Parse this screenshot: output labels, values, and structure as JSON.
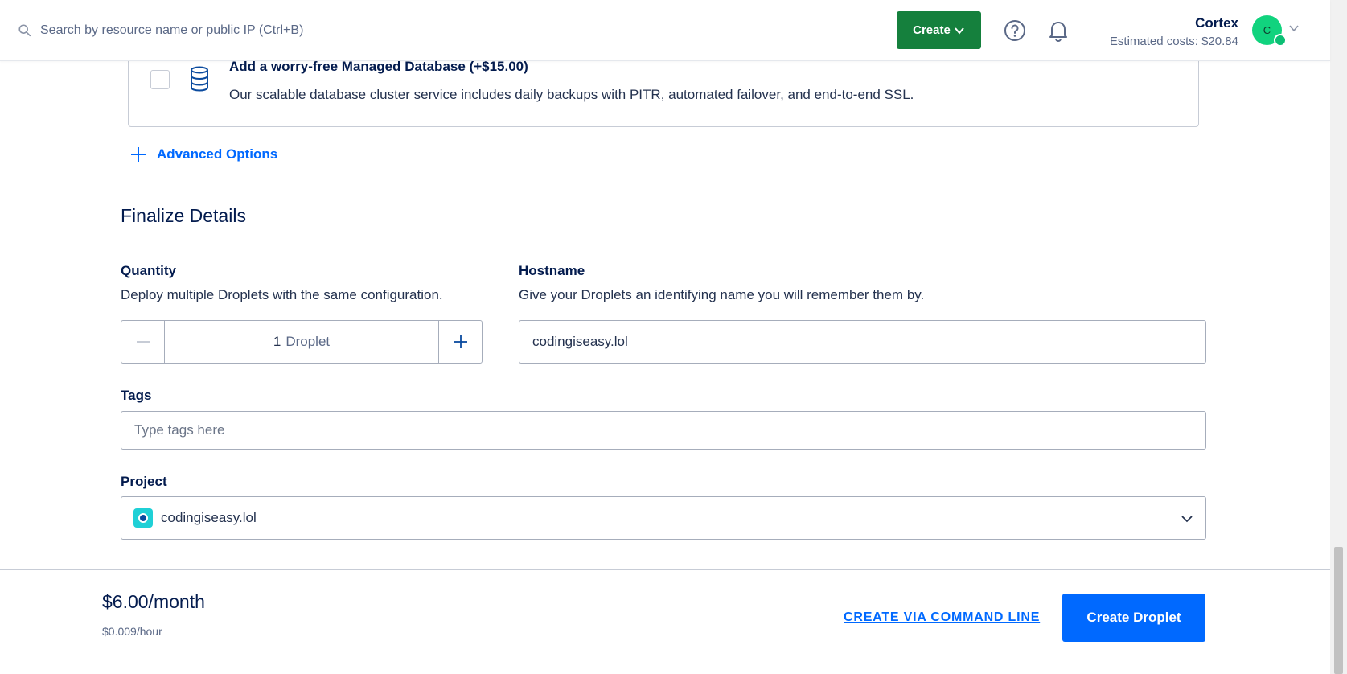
{
  "topbar": {
    "search_placeholder": "Search by resource name or public IP (Ctrl+B)",
    "create_label": "Create",
    "account_name": "Cortex",
    "estimated_costs": "Estimated costs: $20.84",
    "avatar_initial": "C"
  },
  "database_addon": {
    "title": "Add a worry-free Managed Database (+$15.00)",
    "description": "Our scalable database cluster service includes daily backups with PITR, automated failover, and end-to-end SSL.",
    "checked": false
  },
  "advanced_options_label": "Advanced Options",
  "finalize": {
    "title": "Finalize Details",
    "quantity": {
      "label": "Quantity",
      "description": "Deploy multiple Droplets with the same configuration.",
      "value": "1",
      "unit": "Droplet"
    },
    "hostname": {
      "label": "Hostname",
      "description": "Give your Droplets an identifying name you will remember them by.",
      "value": "codingiseasy.lol"
    },
    "tags": {
      "label": "Tags",
      "placeholder": "Type tags here"
    },
    "project": {
      "label": "Project",
      "value": "codingiseasy.lol"
    }
  },
  "footer": {
    "price": "$6.00/month",
    "hourly": "$0.009/hour",
    "cli_link": "CREATE VIA COMMAND LINE",
    "create_button": "Create Droplet"
  },
  "colors": {
    "primary_blue": "#0069ff",
    "create_green": "#15803d",
    "text_navy": "#031b4e",
    "avatar_green": "#11d37e"
  }
}
